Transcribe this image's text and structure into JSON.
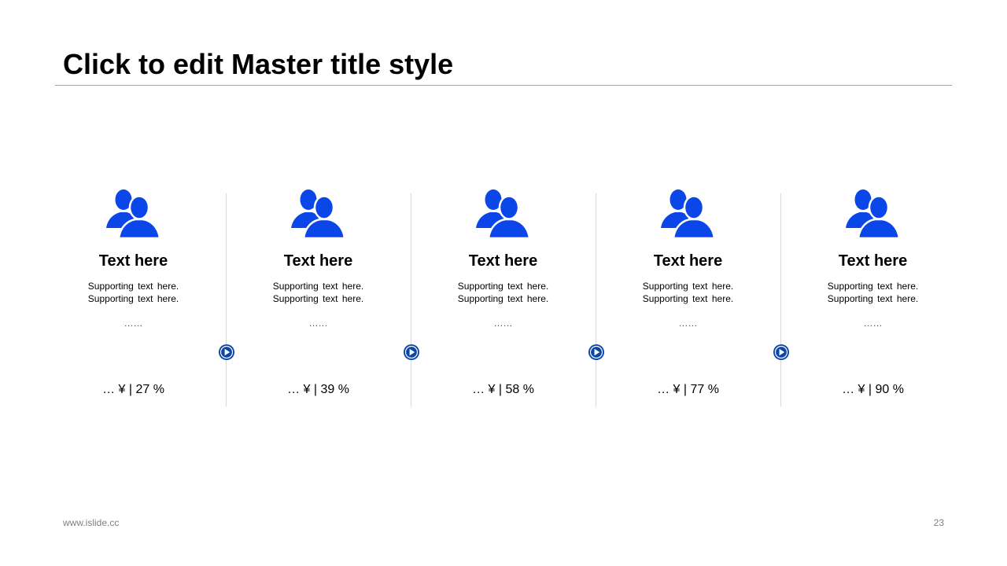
{
  "slide": {
    "title": "Click to edit Master title style",
    "footer_site": "www.islide.cc",
    "page_number": "23",
    "accent_color": "#0a46e8",
    "arrow_color": "#0b47a8",
    "icon": "two-people-icon",
    "items": [
      {
        "title": "Text here",
        "desc_line1": "Supporting  text here.",
        "desc_line2": "Supporting  text here.",
        "dots": "……",
        "stat": "… ¥ | 27 %"
      },
      {
        "title": "Text here",
        "desc_line1": "Supporting  text here.",
        "desc_line2": "Supporting  text here.",
        "dots": "……",
        "stat": "… ¥ | 39 %"
      },
      {
        "title": "Text here",
        "desc_line1": "Supporting  text here.",
        "desc_line2": "Supporting  text here.",
        "dots": "……",
        "stat": "… ¥ | 58 %"
      },
      {
        "title": "Text here",
        "desc_line1": "Supporting  text here.",
        "desc_line2": "Supporting  text here.",
        "dots": "……",
        "stat": "… ¥ | 77 %"
      },
      {
        "title": "Text here",
        "desc_line1": "Supporting  text here.",
        "desc_line2": "Supporting  text here.",
        "dots": "……",
        "stat": "… ¥ | 90 %"
      }
    ]
  }
}
